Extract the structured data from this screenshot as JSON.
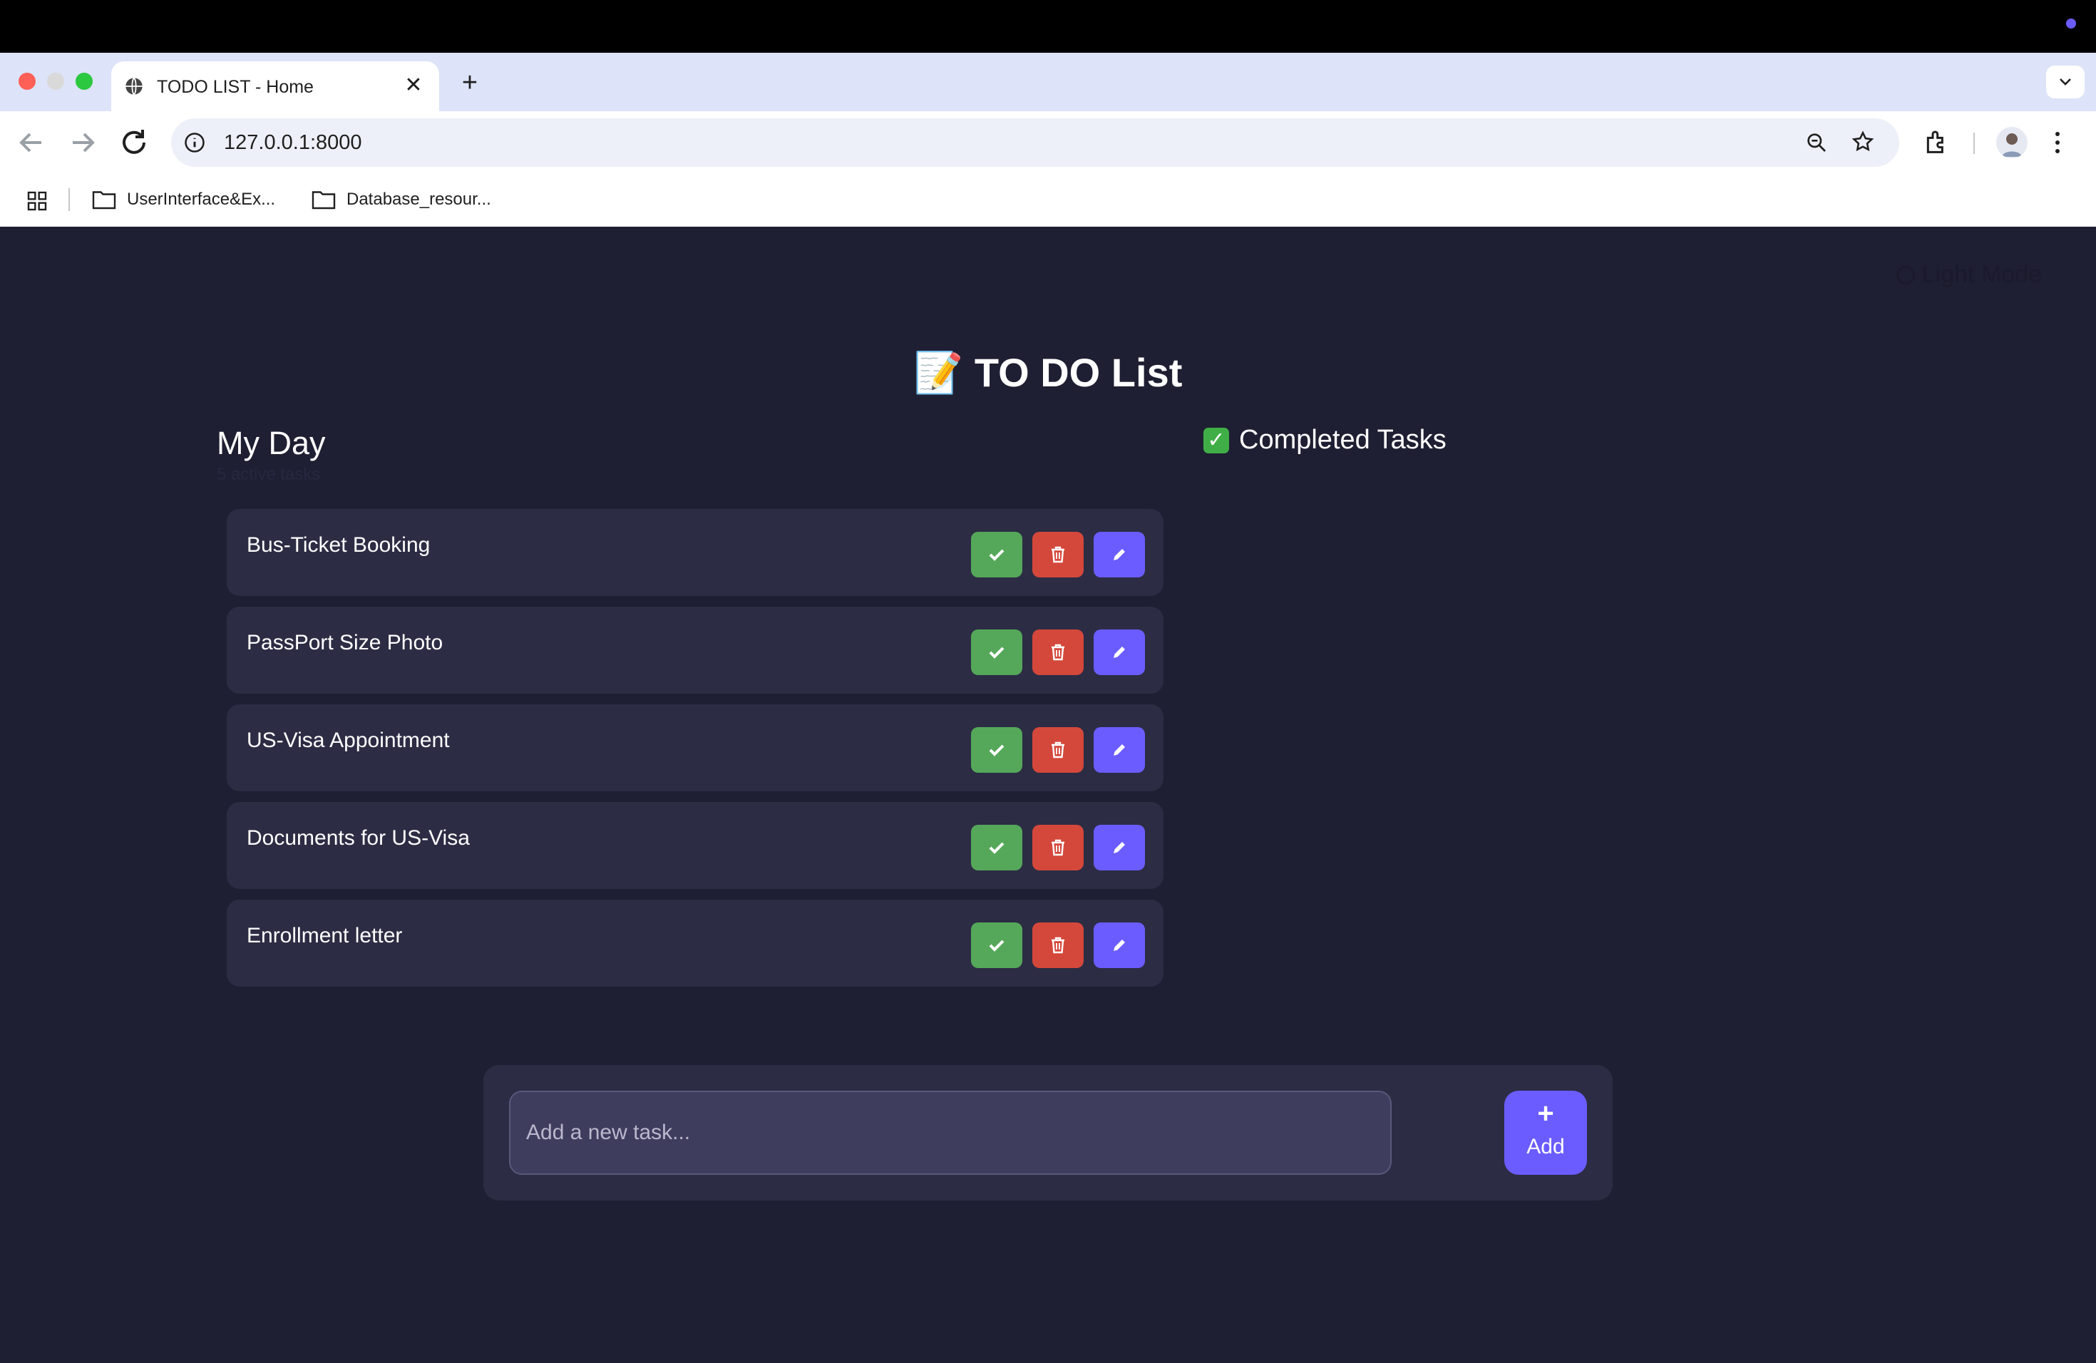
{
  "browser": {
    "tab_title": "TODO LIST - Home",
    "url": "127.0.0.1:8000",
    "bookmarks": [
      {
        "label": "UserInterface&Ex..."
      },
      {
        "label": "Database_resour..."
      }
    ]
  },
  "app": {
    "theme_toggle": "Light Mode",
    "title": "📝 TO DO List",
    "my_day": "My Day",
    "my_day_sub": "5 active tasks",
    "completed_title": "Completed Tasks",
    "tasks": [
      {
        "text": "Bus-Ticket Booking"
      },
      {
        "text": "PassPort Size Photo"
      },
      {
        "text": "US-Visa Appointment"
      },
      {
        "text": "Documents for US-Visa"
      },
      {
        "text": "Enrollment letter"
      }
    ],
    "input_placeholder": "Add a new task...",
    "add_plus": "+",
    "add_label": "Add"
  },
  "colors": {
    "page_bg": "#1f1f33",
    "card_bg": "#2c2c44",
    "done": "#55a85a",
    "delete": "#d4483b",
    "edit": "#6b5cff"
  }
}
